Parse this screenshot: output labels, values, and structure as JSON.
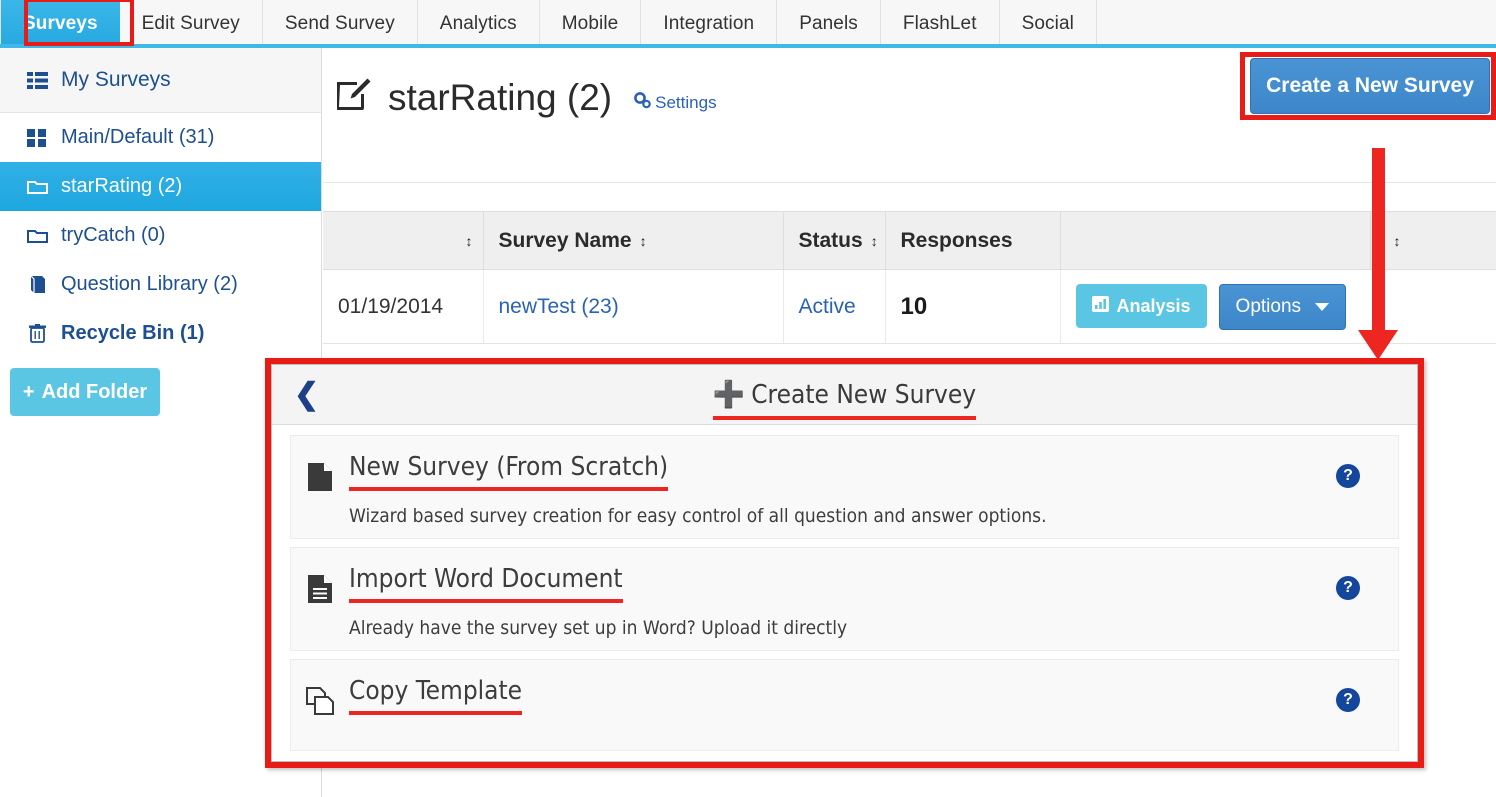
{
  "topnav": {
    "items": [
      {
        "label": "Surveys",
        "active": true
      },
      {
        "label": "Edit Survey",
        "active": false
      },
      {
        "label": "Send Survey",
        "active": false
      },
      {
        "label": "Analytics",
        "active": false
      },
      {
        "label": "Mobile",
        "active": false
      },
      {
        "label": "Integration",
        "active": false
      },
      {
        "label": "Panels",
        "active": false
      },
      {
        "label": "FlashLet",
        "active": false
      },
      {
        "label": "Social",
        "active": false
      }
    ]
  },
  "sidebar": {
    "header": {
      "label": "My Surveys",
      "icon": "list-icon"
    },
    "items": [
      {
        "label": "Main/Default (31)",
        "icon": "grid-icon",
        "selected": false,
        "bold": false
      },
      {
        "label": "starRating (2)",
        "icon": "folder-icon",
        "selected": true,
        "bold": false
      },
      {
        "label": "tryCatch (0)",
        "icon": "folder-icon",
        "selected": false,
        "bold": false
      },
      {
        "label": "Question Library (2)",
        "icon": "book-icon",
        "selected": false,
        "bold": false
      },
      {
        "label": "Recycle Bin (1)",
        "icon": "trash-icon",
        "selected": false,
        "bold": true
      }
    ],
    "add_folder_label": "Add Folder"
  },
  "page": {
    "title": "starRating (2)",
    "title_icon": "edit-square-icon",
    "settings_label": "Settings",
    "settings_icon": "gears-icon",
    "create_button_label": "Create a New Survey"
  },
  "table": {
    "columns": [
      {
        "label": "",
        "sortable": true
      },
      {
        "label": "Survey Name",
        "sortable": true
      },
      {
        "label": "Status",
        "sortable": true
      },
      {
        "label": "Responses",
        "sortable": false
      },
      {
        "label": "",
        "sortable": false
      },
      {
        "label": "",
        "sortable": true
      }
    ],
    "rows": [
      {
        "date": "01/19/2014",
        "name": "newTest (23)",
        "status": "Active",
        "responses": "10",
        "analysis_label": "Analysis",
        "options_label": "Options"
      }
    ]
  },
  "modal": {
    "back_icon": "chevron-left-icon",
    "title": "Create New Survey",
    "title_icon": "plus-icon",
    "options": [
      {
        "title": "New Survey (From Scratch)",
        "description": "Wizard based survey creation for easy control of all question and answer options.",
        "icon": "file-icon",
        "help_icon": "question-mark-icon"
      },
      {
        "title": "Import Word Document",
        "description": "Already have the survey set up in Word? Upload it directly",
        "icon": "file-lines-icon",
        "help_icon": "question-mark-icon"
      },
      {
        "title": "Copy Template",
        "description": "",
        "icon": "copy-icon",
        "help_icon": "question-mark-icon"
      }
    ]
  },
  "annotations": {
    "accent_red": "#e81b17",
    "accent_blue": "#3d86c9",
    "sidebar_active": "#1ea7df"
  }
}
